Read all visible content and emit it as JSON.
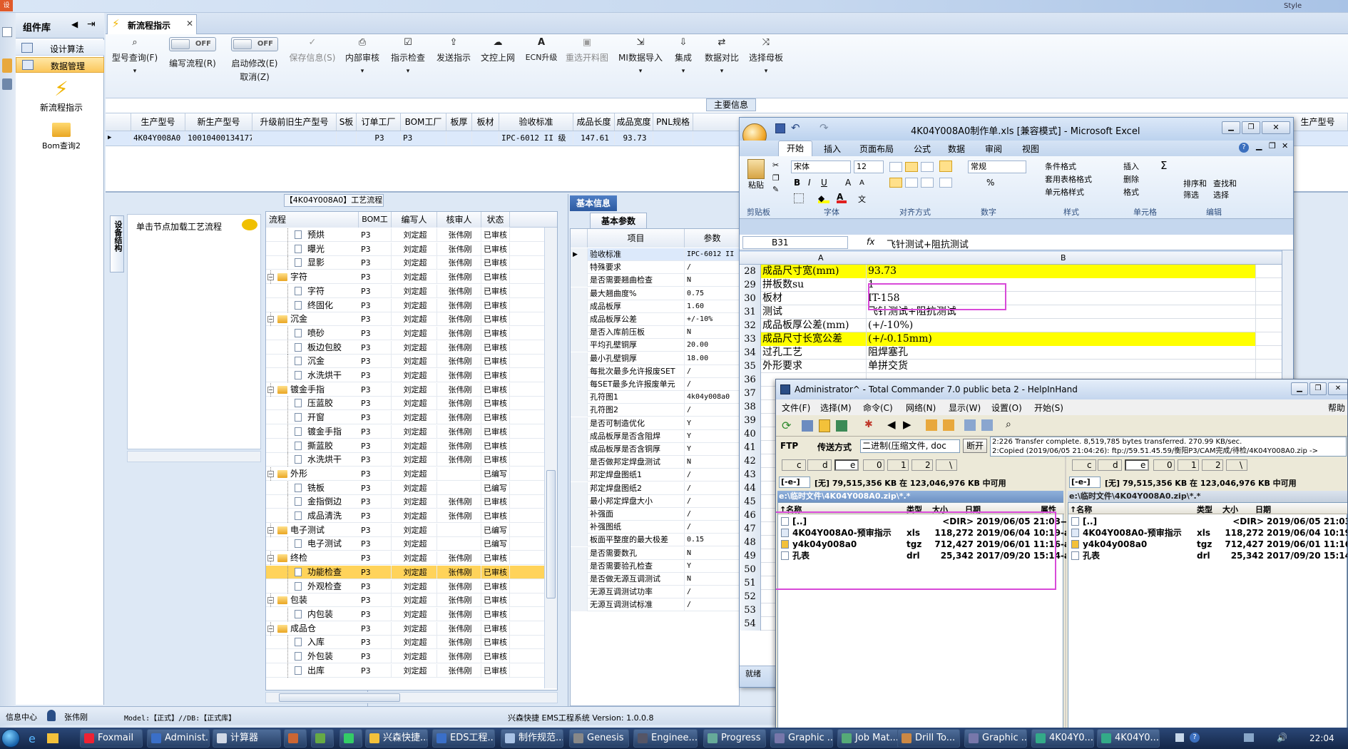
{
  "left_panel": {
    "title": "组件库",
    "items": [
      "设计算法",
      "数据管理"
    ],
    "actions": [
      "新流程指示",
      "Bom查询2"
    ]
  },
  "doc_tab": {
    "label": "新流程指示"
  },
  "toolbar": {
    "buttons": [
      {
        "label": "型号查询(F)",
        "icon": "search-icon",
        "enabled": true
      },
      {
        "label": "编写流程(R)",
        "toggle": "OFF",
        "enabled": true
      },
      {
        "label": "启动修改(E)",
        "sub": "取消(Z)",
        "toggle": "OFF",
        "enabled": true
      },
      {
        "label": "保存信息(S)",
        "icon": "check-icon",
        "enabled": false
      },
      {
        "label": "内部审核",
        "icon": "printer-icon",
        "enabled": true
      },
      {
        "label": "指示检查",
        "icon": "checklist-icon",
        "enabled": true
      },
      {
        "label": "发送指示",
        "icon": "upload-icon",
        "enabled": true
      },
      {
        "label": "文控上网",
        "icon": "cloud-upload-icon",
        "enabled": true
      },
      {
        "label": "ECN升级",
        "icon": "letter-a-icon",
        "enabled": true
      },
      {
        "label": "重选开料图",
        "icon": "image-icon",
        "enabled": false
      },
      {
        "label": "MI数据导入",
        "icon": "import-icon",
        "enabled": true
      },
      {
        "label": "集成",
        "icon": "download-icon",
        "enabled": true
      },
      {
        "label": "数据对比",
        "icon": "compare-icon",
        "enabled": true
      },
      {
        "label": "选择母板",
        "icon": "shuffle-icon",
        "enabled": true
      }
    ]
  },
  "main_info": {
    "title": "主要信息",
    "columns": [
      "生产型号",
      "新生产型号",
      "升级前旧生产型号",
      "S板",
      "订单工厂",
      "BOM工厂",
      "板厚",
      "板材",
      "验收标准",
      "成品长度",
      "成品宽度",
      "PNL规格"
    ],
    "row": [
      "4K04Y008A0",
      "10010400134177",
      "",
      "",
      "P3",
      "P3",
      "",
      "",
      "IPC-6012 II 级",
      "147.61",
      "93.73",
      ""
    ],
    "right_columns": [
      "生产型号"
    ]
  },
  "process": {
    "title": "【4K04Y008A0】工艺流程",
    "side_tab": "设备结构",
    "hint": "单击节点加载工艺流程",
    "columns": [
      "流程",
      "BOM工厂",
      "编写人",
      "核审人",
      "状态"
    ],
    "rows": [
      {
        "name": "预烘",
        "level": 2,
        "factory": "P3",
        "writer": "刘定超",
        "reviewer": "张伟刚",
        "status": "已审核"
      },
      {
        "name": "曝光",
        "level": 2,
        "factory": "P3",
        "writer": "刘定超",
        "reviewer": "张伟刚",
        "status": "已审核"
      },
      {
        "name": "显影",
        "level": 2,
        "factory": "P3",
        "writer": "刘定超",
        "reviewer": "张伟刚",
        "status": "已审核"
      },
      {
        "name": "字符",
        "level": 1,
        "factory": "P3",
        "writer": "刘定超",
        "reviewer": "张伟刚",
        "status": "已审核"
      },
      {
        "name": "字符",
        "level": 2,
        "factory": "P3",
        "writer": "刘定超",
        "reviewer": "张伟刚",
        "status": "已审核"
      },
      {
        "name": "终固化",
        "level": 2,
        "factory": "P3",
        "writer": "刘定超",
        "reviewer": "张伟刚",
        "status": "已审核"
      },
      {
        "name": "沉金",
        "level": 1,
        "factory": "P3",
        "writer": "刘定超",
        "reviewer": "张伟刚",
        "status": "已审核"
      },
      {
        "name": "喷砂",
        "level": 2,
        "factory": "P3",
        "writer": "刘定超",
        "reviewer": "张伟刚",
        "status": "已审核"
      },
      {
        "name": "板边包胶",
        "level": 2,
        "factory": "P3",
        "writer": "刘定超",
        "reviewer": "张伟刚",
        "status": "已审核"
      },
      {
        "name": "沉金",
        "level": 2,
        "factory": "P3",
        "writer": "刘定超",
        "reviewer": "张伟刚",
        "status": "已审核"
      },
      {
        "name": "水洗烘干",
        "level": 2,
        "factory": "P3",
        "writer": "刘定超",
        "reviewer": "张伟刚",
        "status": "已审核"
      },
      {
        "name": "镀金手指",
        "level": 1,
        "factory": "P3",
        "writer": "刘定超",
        "reviewer": "张伟刚",
        "status": "已审核"
      },
      {
        "name": "压蓝胶",
        "level": 2,
        "factory": "P3",
        "writer": "刘定超",
        "reviewer": "张伟刚",
        "status": "已审核"
      },
      {
        "name": "开窗",
        "level": 2,
        "factory": "P3",
        "writer": "刘定超",
        "reviewer": "张伟刚",
        "status": "已审核"
      },
      {
        "name": "镀金手指",
        "level": 2,
        "factory": "P3",
        "writer": "刘定超",
        "reviewer": "张伟刚",
        "status": "已审核"
      },
      {
        "name": "撕蓝胶",
        "level": 2,
        "factory": "P3",
        "writer": "刘定超",
        "reviewer": "张伟刚",
        "status": "已审核"
      },
      {
        "name": "水洗烘干",
        "level": 2,
        "factory": "P3",
        "writer": "刘定超",
        "reviewer": "张伟刚",
        "status": "已审核"
      },
      {
        "name": "外形",
        "level": 1,
        "factory": "P3",
        "writer": "刘定超",
        "reviewer": "",
        "status": "已编写"
      },
      {
        "name": "铣板",
        "level": 2,
        "factory": "P3",
        "writer": "刘定超",
        "reviewer": "",
        "status": "已编写"
      },
      {
        "name": "金指倒边",
        "level": 2,
        "factory": "P3",
        "writer": "刘定超",
        "reviewer": "张伟刚",
        "status": "已审核"
      },
      {
        "name": "成品清洗",
        "level": 2,
        "factory": "P3",
        "writer": "刘定超",
        "reviewer": "张伟刚",
        "status": "已审核"
      },
      {
        "name": "电子测试",
        "level": 1,
        "factory": "P3",
        "writer": "刘定超",
        "reviewer": "",
        "status": "已编写"
      },
      {
        "name": "电子测试",
        "level": 2,
        "factory": "P3",
        "writer": "刘定超",
        "reviewer": "",
        "status": "已编写"
      },
      {
        "name": "终检",
        "level": 1,
        "factory": "P3",
        "writer": "刘定超",
        "reviewer": "张伟刚",
        "status": "已审核"
      },
      {
        "name": "功能检查",
        "level": 2,
        "factory": "P3",
        "writer": "刘定超",
        "reviewer": "张伟刚",
        "status": "已审核",
        "selected": true
      },
      {
        "name": "外观检查",
        "level": 2,
        "factory": "P3",
        "writer": "刘定超",
        "reviewer": "张伟刚",
        "status": "已审核"
      },
      {
        "name": "包装",
        "level": 1,
        "factory": "P3",
        "writer": "刘定超",
        "reviewer": "张伟刚",
        "status": "已审核"
      },
      {
        "name": "内包装",
        "level": 2,
        "factory": "P3",
        "writer": "刘定超",
        "reviewer": "张伟刚",
        "status": "已审核"
      },
      {
        "name": "成品仓",
        "level": 1,
        "factory": "P3",
        "writer": "刘定超",
        "reviewer": "张伟刚",
        "status": "已审核"
      },
      {
        "name": "入库",
        "level": 2,
        "factory": "P3",
        "writer": "刘定超",
        "reviewer": "张伟刚",
        "status": "已审核"
      },
      {
        "name": "外包装",
        "level": 2,
        "factory": "P3",
        "writer": "刘定超",
        "reviewer": "张伟刚",
        "status": "已审核"
      },
      {
        "name": "出库",
        "level": 2,
        "factory": "P3",
        "writer": "刘定超",
        "reviewer": "张伟刚",
        "status": "已审核"
      }
    ]
  },
  "basic_info": {
    "title": "基本信息",
    "tab": "基本参数",
    "columns": [
      "项目",
      "参数"
    ],
    "rows": [
      [
        "验收标准",
        "IPC-6012 II"
      ],
      [
        "特殊要求",
        "/"
      ],
      [
        "是否需要翘曲检查",
        "N"
      ],
      [
        "最大翘曲度%",
        "0.75"
      ],
      [
        "成品板厚",
        "1.60"
      ],
      [
        "成品板厚公差",
        "+/-10%"
      ],
      [
        "是否入库前压板",
        "N"
      ],
      [
        "平均孔壁铜厚",
        "20.00"
      ],
      [
        "最小孔壁铜厚",
        "18.00"
      ],
      [
        "每批次最多允许报废SET",
        "/"
      ],
      [
        "每SET最多允许报废单元",
        "/"
      ],
      [
        "孔符图1",
        "4k04y008a0"
      ],
      [
        "孔符图2",
        "/"
      ],
      [
        "是否可制造优化",
        "Y"
      ],
      [
        "成品板厚是否含阻焊",
        "Y"
      ],
      [
        "成品板厚是否含铜厚",
        "Y"
      ],
      [
        "是否做邦定焊盘测试",
        "N"
      ],
      [
        "邦定焊盘图纸1",
        "/"
      ],
      [
        "邦定焊盘图纸2",
        "/"
      ],
      [
        "最小邦定焊盘大小",
        "/"
      ],
      [
        "补强面",
        "/"
      ],
      [
        "补强图纸",
        "/"
      ],
      [
        "板面平整度的最大极差",
        "0.15"
      ],
      [
        "是否需要数孔",
        "N"
      ],
      [
        "是否需要验孔检查",
        "Y"
      ],
      [
        "是否做无源互调测试",
        "N"
      ],
      [
        "无源互调测试功率",
        "/"
      ],
      [
        "无源互调测试标准",
        "/"
      ]
    ]
  },
  "statusbar": {
    "left": "信息中心",
    "user": "张伟刚",
    "model": "Model:【正式】//DB:【正式库】",
    "system": "兴森快捷 EMS工程系统 Version: 1.0.0.8"
  },
  "excel": {
    "title": "4K04Y008A0制作单.xls [兼容模式] - Microsoft Excel",
    "tabs": [
      "开始",
      "插入",
      "页面布局",
      "公式",
      "数据",
      "审阅",
      "视图"
    ],
    "font_name": "宋体",
    "font_size": "12",
    "number_format": "常规",
    "groups": [
      "剪贴板",
      "字体",
      "对齐方式",
      "数字",
      "样式",
      "单元格",
      "编辑"
    ],
    "paste_label": "粘贴",
    "style_items": [
      "条件格式",
      "套用表格格式",
      "单元格样式"
    ],
    "cell_items": [
      "插入",
      "删除",
      "格式"
    ],
    "edit_items": [
      "排序和筛选",
      "查找和选择"
    ],
    "namebox": "B31",
    "formula": "飞针测试+阻抗测试",
    "col_a": "A",
    "col_b": "B",
    "rows": [
      {
        "n": "28",
        "a": "成品尺寸宽(mm)",
        "b": "93.73",
        "hl": true
      },
      {
        "n": "29",
        "a": "拼板数su",
        "b": "1"
      },
      {
        "n": "30",
        "a": "板材",
        "b": "IT-158"
      },
      {
        "n": "31",
        "a": "测试",
        "b": "飞针测试+阻抗测试"
      },
      {
        "n": "32",
        "a": "成品板厚公差(mm)",
        "b": "(+/-10%)"
      },
      {
        "n": "33",
        "a": "成品尺寸长宽公差",
        "b": "(+/-0.15mm)",
        "hl": true
      },
      {
        "n": "34",
        "a": "过孔工艺",
        "b": "阻焊塞孔"
      },
      {
        "n": "35",
        "a": "外形要求",
        "b": "单拼交货"
      },
      {
        "n": "36",
        "a": "",
        "b": ""
      }
    ],
    "more_rows": [
      "37",
      "38",
      "39",
      "40",
      "41",
      "42",
      "43",
      "44",
      "45",
      "46",
      "47",
      "48",
      "49",
      "50",
      "51",
      "52",
      "53",
      "54"
    ],
    "bottom_label": "就绪"
  },
  "tc": {
    "title": "Administrator^ - Total Commander 7.0 public beta 2 - HelpInHand",
    "menu": [
      "文件(F)",
      "选择(M)",
      "命令(C)",
      "网络(N)",
      "显示(W)",
      "设置(O)",
      "开始(S)"
    ],
    "help": "帮助",
    "ftp_label": "FTP",
    "transfer_label": "传送方式",
    "transfer_mode": "二进制(压缩文件, doc 等)",
    "disconnect": "断开",
    "log1": "2:226 Transfer complete. 8,519,785 bytes transferred. 270.99 KB/sec.",
    "log2": "2:Copied (2019/06/05 21:04:26): ftp://59.51.45.59/衡阳P3/CAM完成/待检/4K04Y008A0.zip ->",
    "drives": [
      "c",
      "d",
      "e",
      "0",
      "1",
      "2",
      "\\"
    ],
    "drive_combo": "[-e-]",
    "free_space": "[无] 79,515,356 KB 在 123,046,976 KB 中可用",
    "path": "e:\\临时文件\\4K04Y008A0.zip\\*.*",
    "headers": [
      "↑名称",
      "类型",
      "大小",
      "日期",
      "属性"
    ],
    "files": [
      {
        "name": "[..]",
        "type": "",
        "size": "<DIR>",
        "date": "2019/06/05 21:03—",
        "attr": ""
      },
      {
        "name": "4K04Y008A0-预审指示",
        "type": "xls",
        "size": "118,272",
        "date": "2019/06/04 10:19-a-",
        "attr": ""
      },
      {
        "name": "y4k04y008a0",
        "type": "tgz",
        "size": "712,427",
        "date": "2019/06/01 11:16-a-",
        "attr": ""
      },
      {
        "name": "孔表",
        "type": "drl",
        "size": "25,342",
        "date": "2017/09/20 15:14-a-",
        "attr": ""
      }
    ],
    "files_right": [
      {
        "name": "[..]",
        "type": "",
        "size": "<DIR>",
        "date": "2019/06/05 21:03—"
      },
      {
        "name": "4K04Y008A0-预审指示",
        "type": "xls",
        "size": "118,272",
        "date": "2019/06/04 10:19-a-"
      },
      {
        "name": "y4k04y008a0",
        "type": "tgz",
        "size": "712,427",
        "date": "2019/06/01 11:16-a-"
      },
      {
        "name": "孔表",
        "type": "drl",
        "size": "25,342",
        "date": "2017/09/20 15:14-a-"
      }
    ]
  },
  "taskbar": {
    "items": [
      "Foxmail",
      "Administ...",
      "计算器",
      "",
      "",
      "",
      "兴森快捷...",
      "EDS工程...",
      "制作规范...",
      "Genesis",
      "Enginee...",
      "Progress",
      "Graphic ...",
      "Job Mat...",
      "Drill To...",
      "Graphic ...",
      "4K04Y0...",
      "4K04Y0..."
    ],
    "clock": "22:04"
  },
  "style_label": "Style",
  "colors": {
    "accent": "#2b5797",
    "highlight_yellow": "#ffff00",
    "selection_yellow": "#ffd35a",
    "annotation": "#d84ad8"
  }
}
